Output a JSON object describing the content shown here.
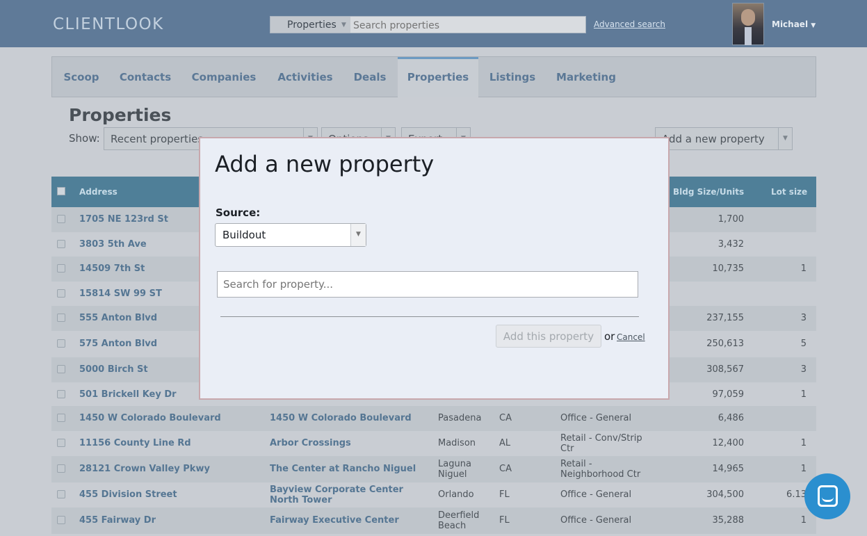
{
  "header": {
    "logo": "CLIENTLOOK",
    "search_scope": "Properties",
    "search_placeholder": "Search properties",
    "advanced_search": "Advanced search",
    "user_name": "Michael"
  },
  "nav": {
    "tabs": [
      {
        "label": "Scoop"
      },
      {
        "label": "Contacts"
      },
      {
        "label": "Companies"
      },
      {
        "label": "Activities"
      },
      {
        "label": "Deals"
      },
      {
        "label": "Properties",
        "active": true
      },
      {
        "label": "Listings"
      },
      {
        "label": "Marketing"
      }
    ]
  },
  "page": {
    "title": "Properties",
    "show_label": "Show:",
    "show_select": "Recent properties",
    "options_select": "Options",
    "export_select": "Export",
    "add_property_button": "Add a new property"
  },
  "table": {
    "headers": {
      "address": "Address",
      "bldg_size": "Bldg Size/Units",
      "lot_size": "Lot size"
    },
    "rows": [
      {
        "address": "1705 NE 123rd St",
        "name": "",
        "city": "",
        "state": "",
        "type": "",
        "size": "1,700",
        "lot": ""
      },
      {
        "address": "3803 5th Ave",
        "name": "",
        "city": "",
        "state": "",
        "type": "",
        "size": "3,432",
        "lot": ""
      },
      {
        "address": "14509 7th St",
        "name": "",
        "city": "",
        "state": "",
        "type": "",
        "size": "10,735",
        "lot": "1"
      },
      {
        "address": "15814 SW 99 ST",
        "name": "",
        "city": "",
        "state": "",
        "type": "",
        "size": "",
        "lot": ""
      },
      {
        "address": "555 Anton Blvd",
        "name": "",
        "city": "",
        "state": "",
        "type": "",
        "size": "237,155",
        "lot": "3"
      },
      {
        "address": "575 Anton Blvd",
        "name": "",
        "city": "",
        "state": "",
        "type": "",
        "size": "250,613",
        "lot": "5"
      },
      {
        "address": "5000 Birch St",
        "name": "",
        "city": "",
        "state": "",
        "type": "",
        "size": "308,567",
        "lot": "3"
      },
      {
        "address": "501 Brickell Key Dr",
        "name": "",
        "city": "",
        "state": "",
        "type": "",
        "size": "97,059",
        "lot": "1"
      },
      {
        "address": "1450 W Colorado Boulevard",
        "name": "1450 W Colorado Boulevard",
        "city": "Pasadena",
        "state": "CA",
        "type": "Office - General",
        "size": "6,486",
        "lot": ""
      },
      {
        "address": "11156 County Line Rd",
        "name": "Arbor Crossings",
        "city": "Madison",
        "state": "AL",
        "type": "Retail - Conv/Strip Ctr",
        "size": "12,400",
        "lot": "1"
      },
      {
        "address": "28121 Crown Valley Pkwy",
        "name": "The Center at Rancho Niguel",
        "city": "Laguna Niguel",
        "state": "CA",
        "type": "Retail - Neighborhood Ctr",
        "size": "14,965",
        "lot": "1"
      },
      {
        "address": "455 Division Street",
        "name": "Bayview Corporate Center North Tower",
        "city": "Orlando",
        "state": "FL",
        "type": "Office - General",
        "size": "304,500",
        "lot": "6.13"
      },
      {
        "address": "455 Fairway Dr",
        "name": "Fairway Executive Center",
        "city": "Deerfield Beach",
        "state": "FL",
        "type": "Office - General",
        "size": "35,288",
        "lot": "1"
      }
    ]
  },
  "modal": {
    "title": "Add a new property",
    "source_label": "Source:",
    "source_value": "Buildout",
    "search_placeholder": "Search for property...",
    "add_button": "Add this property",
    "or_text": "or",
    "cancel": "Cancel"
  },
  "icons": {
    "chat": "chat-icon",
    "dropdown": "chevron-down-icon"
  },
  "colors": {
    "header_bg": "#5f7a98",
    "table_header_bg": "#4f7f98",
    "link": "#557693",
    "chat": "#2b8fcf"
  }
}
